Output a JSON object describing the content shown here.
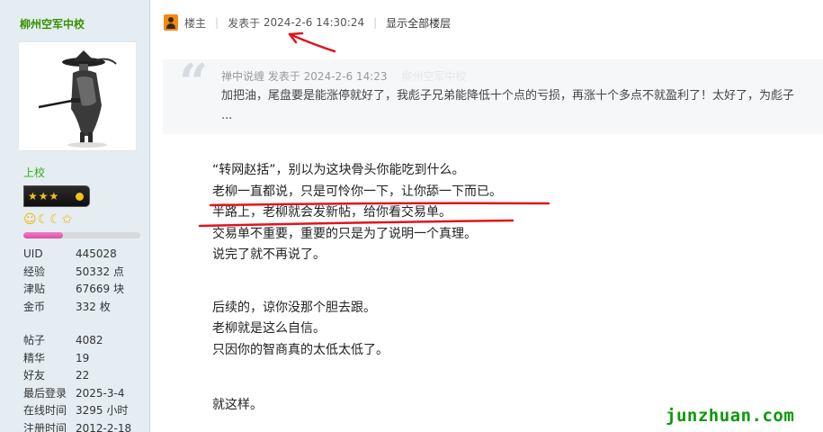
{
  "user": {
    "name": "柳州空军中校",
    "rank": "上校",
    "rank_stars": "★★★",
    "medals": "☺☾☾✩",
    "level_progress": 0.34,
    "stats": [
      {
        "label": "UID",
        "value": "445028"
      },
      {
        "label": "经验",
        "value": "50332 点"
      },
      {
        "label": "津贴",
        "value": "67669 块"
      },
      {
        "label": "金币",
        "value": "332 枚"
      }
    ],
    "stats2": [
      {
        "label": "帖子",
        "value": "4082"
      },
      {
        "label": "精华",
        "value": "19"
      },
      {
        "label": "好友",
        "value": "22"
      },
      {
        "label": "最后登录",
        "value": "2025-3-4"
      },
      {
        "label": "在线时间",
        "value": "3295 小时"
      },
      {
        "label": "注册时间",
        "value": "2012-2-18"
      }
    ]
  },
  "post": {
    "role": "楼主",
    "posted_label": "发表于",
    "posted_time": "2024-2-6 14:30:24",
    "show_all": "显示全部楼层"
  },
  "quote": {
    "author": "禅中说缠",
    "posted": "发表于 2024-2-6 14:23",
    "faded": "柳州空军中校",
    "text": "加把油，尾盘要是能涨停就好了，我彪子兄弟能降低十个点的亏损，再涨十个多点不就盈利了！太好了，为彪子 ..."
  },
  "message": {
    "p1": [
      "“转网赵括”，别以为这块骨头你能吃到什么。",
      "老柳一直都说，只是可怜你一下，让你舔一下而已。",
      "半路上，老柳就会发新帖，给你看交易单。",
      "交易单不重要，重要的只是为了说明一个真理。",
      "说完了就不再说了。"
    ],
    "p2": [
      "后续的，谅你没那个胆去跟。",
      "老柳就是这么自信。",
      "只因你的智商真的太低太低了。"
    ],
    "p3": [
      "就这样。"
    ]
  },
  "watermark": "junzhuan.com",
  "colors": {
    "username": "#369200",
    "rank": "#2fae12",
    "level_bar": "#d84fa8",
    "annotation": "#e0141e",
    "watermark": "#0a9a0a"
  }
}
